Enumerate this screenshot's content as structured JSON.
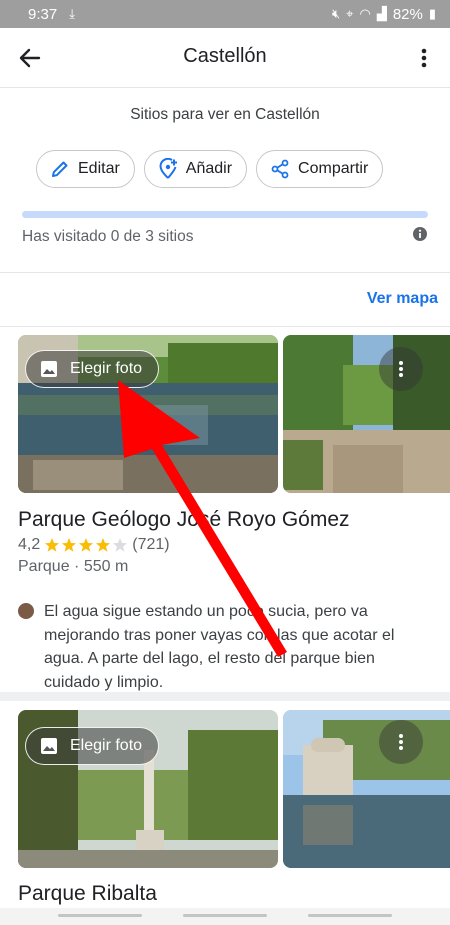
{
  "status_bar": {
    "time": "9:37",
    "battery": "82%"
  },
  "app_bar": {
    "title": "Castellón"
  },
  "subtitle": "Sitios para ver en Castellón",
  "actions": [
    {
      "label": "Editar",
      "icon": "pencil-icon"
    },
    {
      "label": "Añadir",
      "icon": "add-place-icon"
    },
    {
      "label": "Compartir",
      "icon": "share-icon"
    }
  ],
  "progress": {
    "visited": 0,
    "total": 3,
    "text": "Has visitado 0 de 3 sitios"
  },
  "map_link": "Ver mapa",
  "places": [
    {
      "name": "Parque Geólogo José Royo Gómez",
      "rating": "4,2",
      "stars": 4.2,
      "reviews": "(721)",
      "meta": "Parque · 550 m",
      "review": "El agua sigue estando un poco sucia, pero va mejorando tras poner vayas con las que acotar el agua. A parte del lago, el resto del parque bien cuidado y limpio.",
      "pick_photo_label": "Elegir foto"
    },
    {
      "name": "Parque Ribalta",
      "pick_photo_label": "Elegir foto"
    }
  ],
  "colors": {
    "accent": "#1a73e8",
    "star": "#fbbc04",
    "annotation_arrow": "#ff0000"
  }
}
